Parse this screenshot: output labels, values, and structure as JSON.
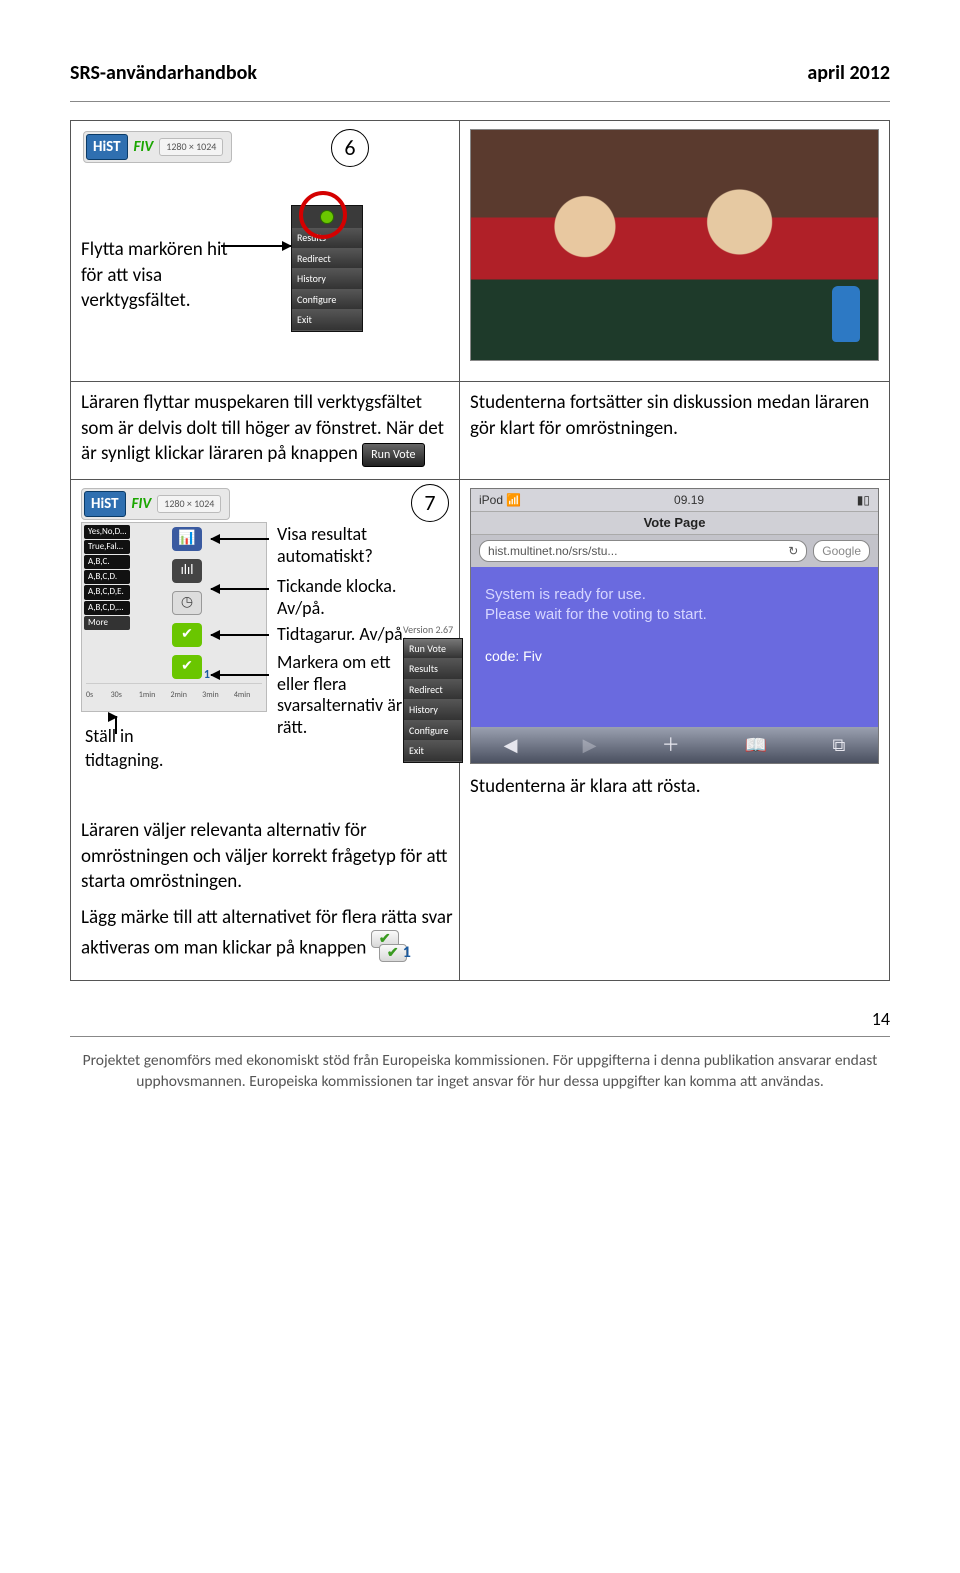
{
  "header": {
    "left": "SRS-användarhandbok",
    "right": "april 2012"
  },
  "step6": {
    "number": "6",
    "caption": "Flytta markören hit för att visa verktygsfältet.",
    "fiv": "FIV",
    "dd": "1280 × 1024",
    "toolbar": [
      "Results",
      "Redirect",
      "History",
      "Configure",
      "Exit"
    ],
    "text_left_a": "Läraren flyttar muspekaren till verktygsfältet som är delvis dolt till höger av fönstret. När det är synligt klickar läraren på knappen",
    "runvote": "Run Vote",
    "text_right": "Studenterna fortsätter sin diskussion medan läraren gör klart för omröstningen."
  },
  "step7": {
    "number": "7",
    "fiv": "FIV",
    "dd": "1280 × 1024",
    "qtypes": [
      "Yes,No,D…",
      "True,Fal…",
      "A,B,C.",
      "A,B,C,D.",
      "A,B,C,D,E.",
      "A,B,C,D,…"
    ],
    "more": "More",
    "ticks": [
      "0s",
      "30s",
      "1min",
      "2min",
      "3min",
      "4min"
    ],
    "labels": {
      "visa": "Visa resultat automatiskt?",
      "tick": "Tickande klocka. Av/på.",
      "tidt": "Tidtagarur. Av/på.",
      "mark": "Markera om ett eller flera svarsalternativ är rätt.",
      "stall": "Ställ in tidtagning."
    },
    "version": "Version 2.67",
    "tb2": [
      "Run Vote",
      "Results",
      "Redirect",
      "History",
      "Configure",
      "Exit"
    ],
    "ipod": {
      "carrier": "iPod",
      "time": "09.19",
      "title": "Vote Page",
      "url": "hist.multinet.no/srs/stu...",
      "refresh": "↻",
      "google": "Google",
      "msg1": "System is ready for use.",
      "msg2": "Please wait for the voting to start.",
      "code": "code: Fiv",
      "bb_back": "◀",
      "bb_plus": "＋",
      "bb_bm": "📖",
      "bb_tabs": "⧉"
    },
    "para1": "Läraren väljer relevanta alternativ för omröstningen och väljer korrekt frågetyp för att starta omröstningen.",
    "para2": "Lägg märke till att alternativet för flera rätta svar aktiveras om man klickar på knappen",
    "right_para": "Studenterna är klara att rösta."
  },
  "pagenum": "14",
  "footer": {
    "l1": "Projektet genomförs med ekonomiskt stöd från Europeiska kommissionen. För uppgifterna i denna publikation ansvarar endast",
    "l2": "upphovsmannen. Europeiska kommissionen tar inget ansvar för hur dessa uppgifter kan komma att användas."
  }
}
